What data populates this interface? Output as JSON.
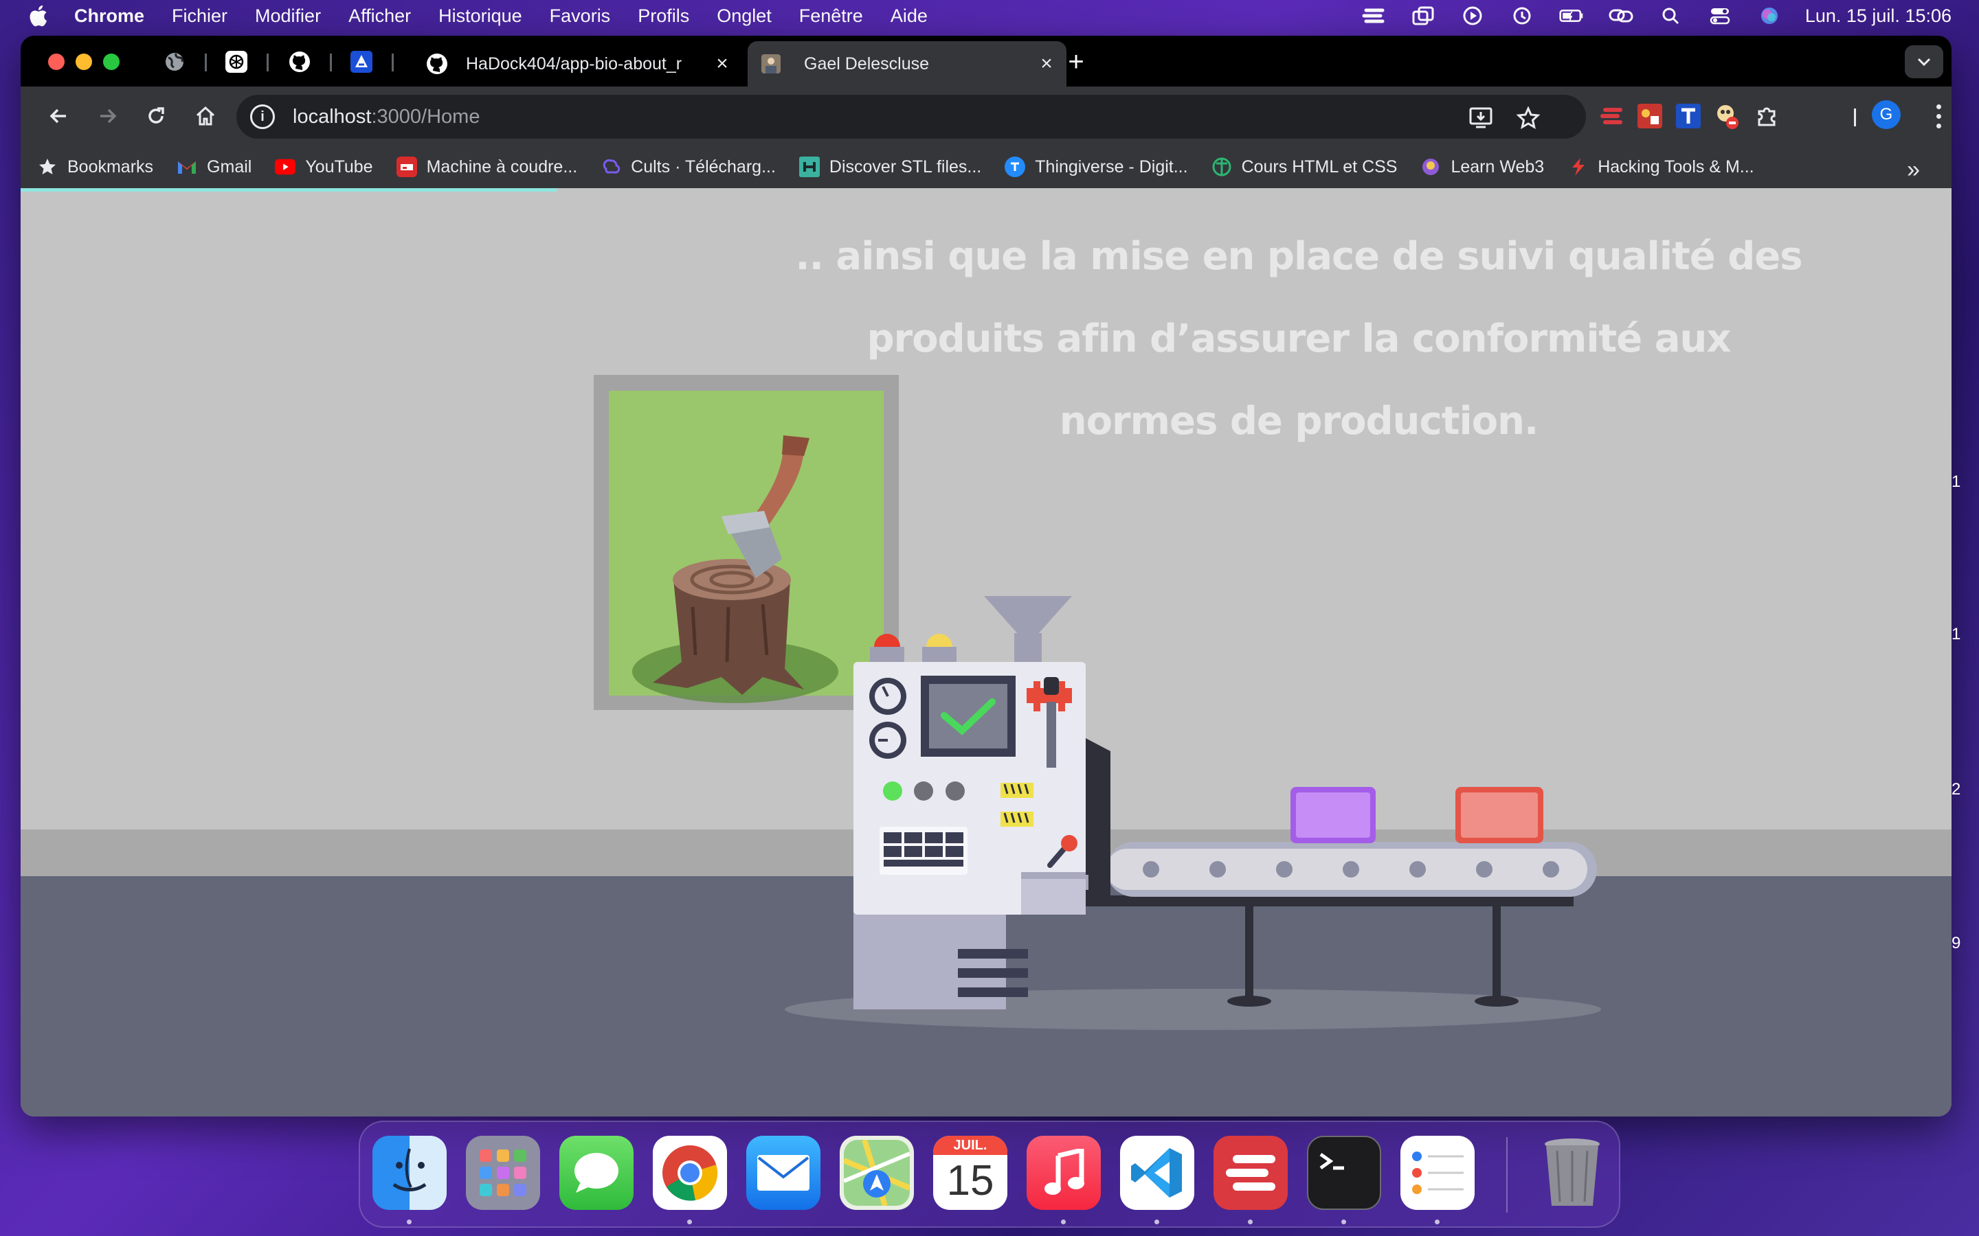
{
  "menubar": {
    "app_name": "Chrome",
    "items": [
      "Fichier",
      "Modifier",
      "Afficher",
      "Historique",
      "Favoris",
      "Profils",
      "Onglet",
      "Fenêtre",
      "Aide"
    ],
    "clock": "Lun. 15 juil.  15:06"
  },
  "tabs": [
    {
      "title": "HaDock404/app-bio-about_r",
      "close": "×"
    },
    {
      "title": "Gael Delescluse",
      "close": "×"
    }
  ],
  "newtab_label": "+",
  "address": {
    "host": "localhost",
    "path": ":3000/Home",
    "info": "i"
  },
  "profile_initial": "G",
  "bookmarks": [
    {
      "label": "Bookmarks",
      "icon": "star-icon"
    },
    {
      "label": "Gmail",
      "icon": "gmail-icon"
    },
    {
      "label": "YouTube",
      "icon": "youtube-icon"
    },
    {
      "label": "Machine à coudre...",
      "icon": "sewing-icon"
    },
    {
      "label": "Cults  ·  Télécharg...",
      "icon": "cults-icon"
    },
    {
      "label": "Discover STL files...",
      "icon": "stl-icon"
    },
    {
      "label": "Thingiverse - Digit...",
      "icon": "thingiverse-icon"
    },
    {
      "label": "Cours HTML et CSS",
      "icon": "openclassrooms-icon"
    },
    {
      "label": "Learn Web3",
      "icon": "web3-icon"
    },
    {
      "label": "Hacking Tools & M...",
      "icon": "hacking-icon"
    }
  ],
  "bookmarks_more": "»",
  "page": {
    "caption_lines": [
      ".. ainsi que la mise en place de suivi qualité des",
      "produits afin d’assurer la conformité aux",
      "normes de production."
    ],
    "edge_marks": [
      "1",
      "1",
      "2",
      "9"
    ]
  },
  "dock": {
    "calendar_month": "JUIL.",
    "calendar_day": "15",
    "apps": [
      "finder-icon",
      "launchpad-icon",
      "messages-icon",
      "chrome-icon",
      "mail-icon",
      "maps-icon",
      "calendar-icon",
      "music-icon",
      "vscode-icon",
      "expressvpn-icon",
      "terminal-icon",
      "reminders-icon",
      "trash-icon"
    ]
  },
  "colors": {
    "wall": "#c4c4c4",
    "floor": "#636778",
    "caption": "#e7e7e7",
    "purple_box": "#b77cf0",
    "red_box": "#ee8a85",
    "picture_bg": "#9ac76b"
  }
}
